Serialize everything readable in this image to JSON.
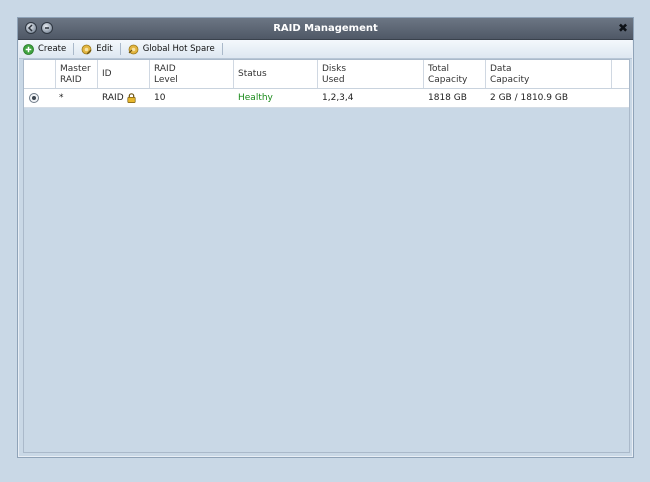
{
  "window": {
    "title": "RAID Management",
    "close_glyph": "✖"
  },
  "toolbar": {
    "items": [
      {
        "label": "Create",
        "icon": "add-icon"
      },
      {
        "label": "Edit",
        "icon": "edit-icon"
      },
      {
        "label": "Global Hot Spare",
        "icon": "hot-spare-icon"
      }
    ]
  },
  "table": {
    "columns": [
      {
        "line1": "",
        "line2": ""
      },
      {
        "line1": "Master",
        "line2": "RAID"
      },
      {
        "line1": "ID",
        "line2": ""
      },
      {
        "line1": "RAID",
        "line2": "Level"
      },
      {
        "line1": "Status",
        "line2": ""
      },
      {
        "line1": "Disks",
        "line2": "Used"
      },
      {
        "line1": "Total",
        "line2": "Capacity"
      },
      {
        "line1": "Data",
        "line2": "Capacity"
      }
    ],
    "rows": [
      {
        "selected": true,
        "master": "*",
        "id": "RAID",
        "locked": true,
        "level": "10",
        "status": "Healthy",
        "disks": "1,2,3,4",
        "total": "1818 GB",
        "data": "2 GB / 1810.9 GB"
      }
    ]
  },
  "colors": {
    "status_healthy": "#1a8a1a",
    "titlebar": "#5a6472",
    "background": "#c9d8e6"
  }
}
